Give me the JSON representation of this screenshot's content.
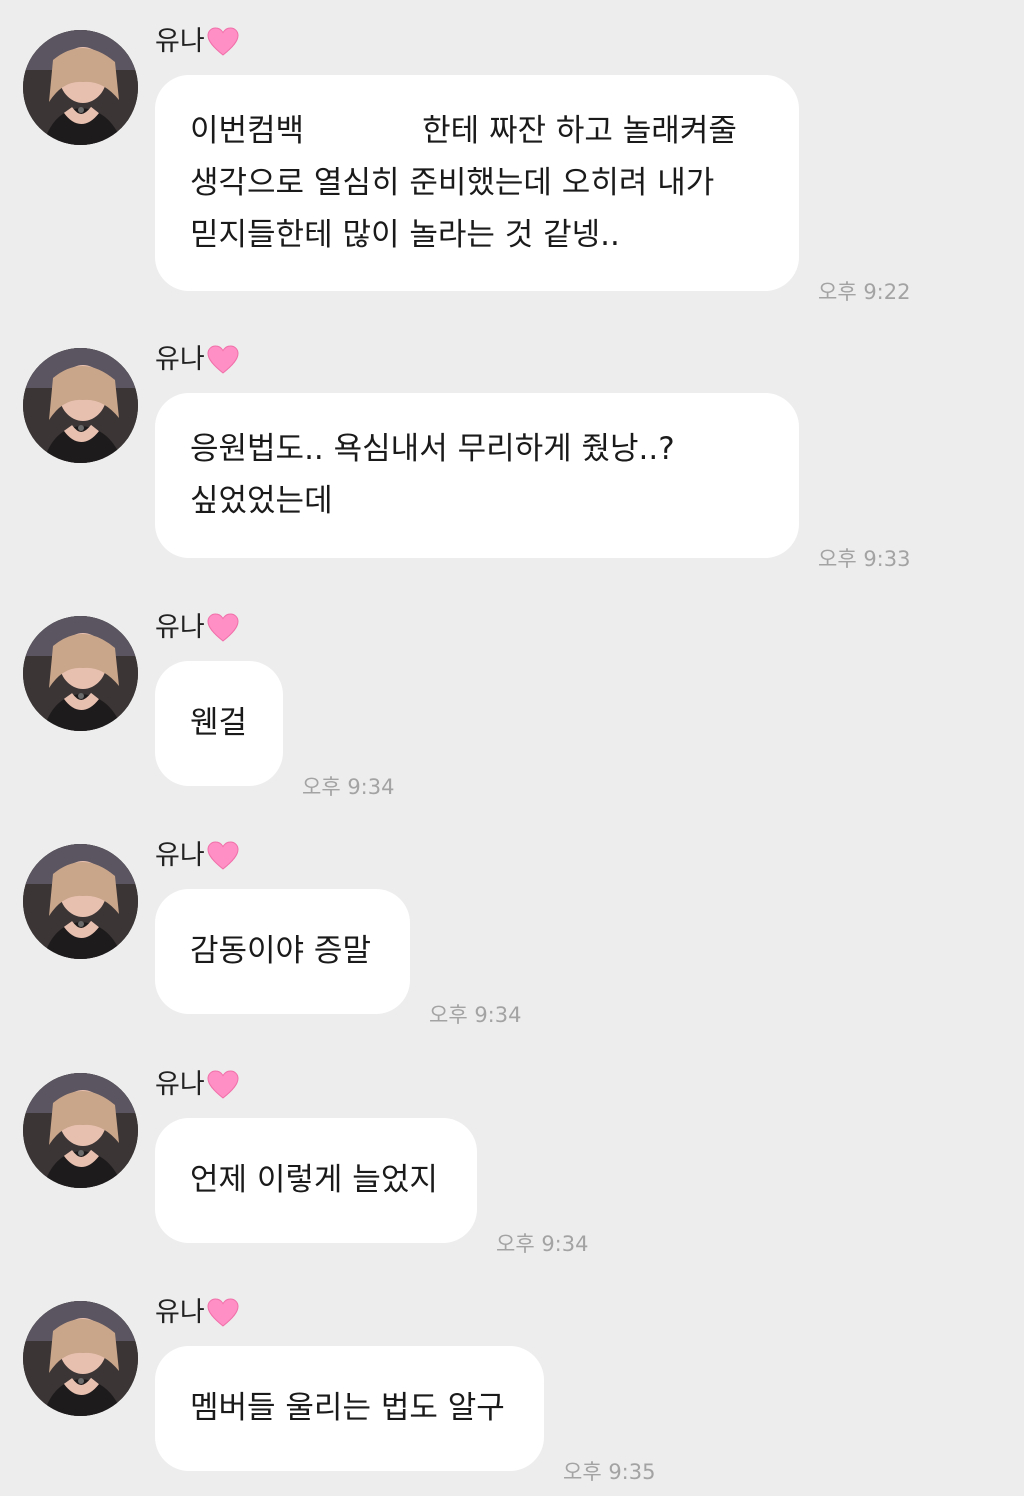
{
  "sender": {
    "name": "유나",
    "name_emoji": "pink-heart"
  },
  "messages": [
    {
      "lines": [
        "이번컴백 ▒▒▒▒▒▒▒ 한테 짜잔 하고 놀래켜줄",
        "생각으로 열심히 준비했는데 오히려 내가",
        "믿지들한테 많이 놀라는 것 같넹.."
      ],
      "line1_start": "이번컴백",
      "line1_end": "한테 짜잔 하고 놀래켜줄",
      "time": "오후 9:22"
    },
    {
      "lines": [
        "응원법도.. 욕심내서 무리하게 줬낭..?",
        "싶었었는데"
      ],
      "time": "오후 9:33"
    },
    {
      "lines": [
        "웬걸"
      ],
      "time": "오후 9:34"
    },
    {
      "lines": [
        "감동이야 증말"
      ],
      "time": "오후 9:34"
    },
    {
      "lines": [
        "언제 이렇게 늘었지"
      ],
      "time": "오후 9:34"
    },
    {
      "lines": [
        "멤버들 울리는 법도 알구"
      ],
      "time": "오후 9:35"
    }
  ],
  "colors": {
    "background": "#ededed",
    "bubble": "#ffffff",
    "time_text": "#a3a3a3",
    "heart": "#ff8fc4"
  }
}
